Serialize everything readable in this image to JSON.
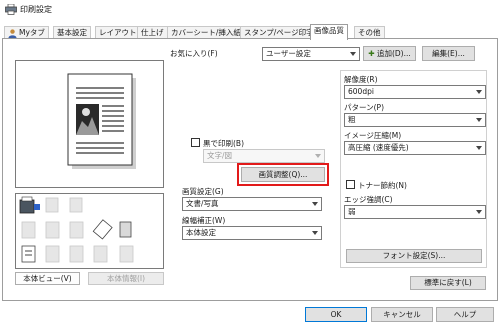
{
  "window": {
    "title": "印刷設定"
  },
  "tabs": [
    {
      "label": "Myタブ"
    },
    {
      "label": "基本設定"
    },
    {
      "label": "レイアウト"
    },
    {
      "label": "仕上げ"
    },
    {
      "label": "カバーシート/挿入紙"
    },
    {
      "label": "スタンプ/ページ印字"
    },
    {
      "label": "画像品質",
      "active": true
    },
    {
      "label": "その他"
    }
  ],
  "left_panel": {
    "view_button": "本体ビュー(V)",
    "info_button": "本体情報(I)"
  },
  "favorites": {
    "label": "お気に入り(F)",
    "value": "ユーザー設定",
    "add_button": "追加(D)...",
    "edit_button": "編集(E)..."
  },
  "black_print": {
    "label": "黒で印刷(B)",
    "checked": false,
    "value": "文字/図"
  },
  "quality_adjust_button": "画質調整(Q)...",
  "image_setting": {
    "label": "画質設定(G)",
    "value": "文書/写真"
  },
  "line_width": {
    "label": "線幅補正(W)",
    "value": "本体設定"
  },
  "resolution": {
    "label": "解像度(R)",
    "value": "600dpi"
  },
  "pattern": {
    "label": "パターン(P)",
    "value": "粗"
  },
  "compression": {
    "label": "イメージ圧縮(M)",
    "value": "高圧縮 (速度優先)"
  },
  "toner_save": {
    "label": "トナー節約(N)",
    "checked": false
  },
  "edge_enhance": {
    "label": "エッジ強調(C)",
    "value": "弱"
  },
  "font_settings_button": "フォント設定(S)...",
  "restore_defaults_button": "標準に戻す(L)",
  "footer": {
    "ok": "OK",
    "cancel": "キャンセル",
    "help": "ヘルプ"
  },
  "colors": {
    "accent_outline": "#e21a1a",
    "tab_border": "#9d9d9d"
  }
}
